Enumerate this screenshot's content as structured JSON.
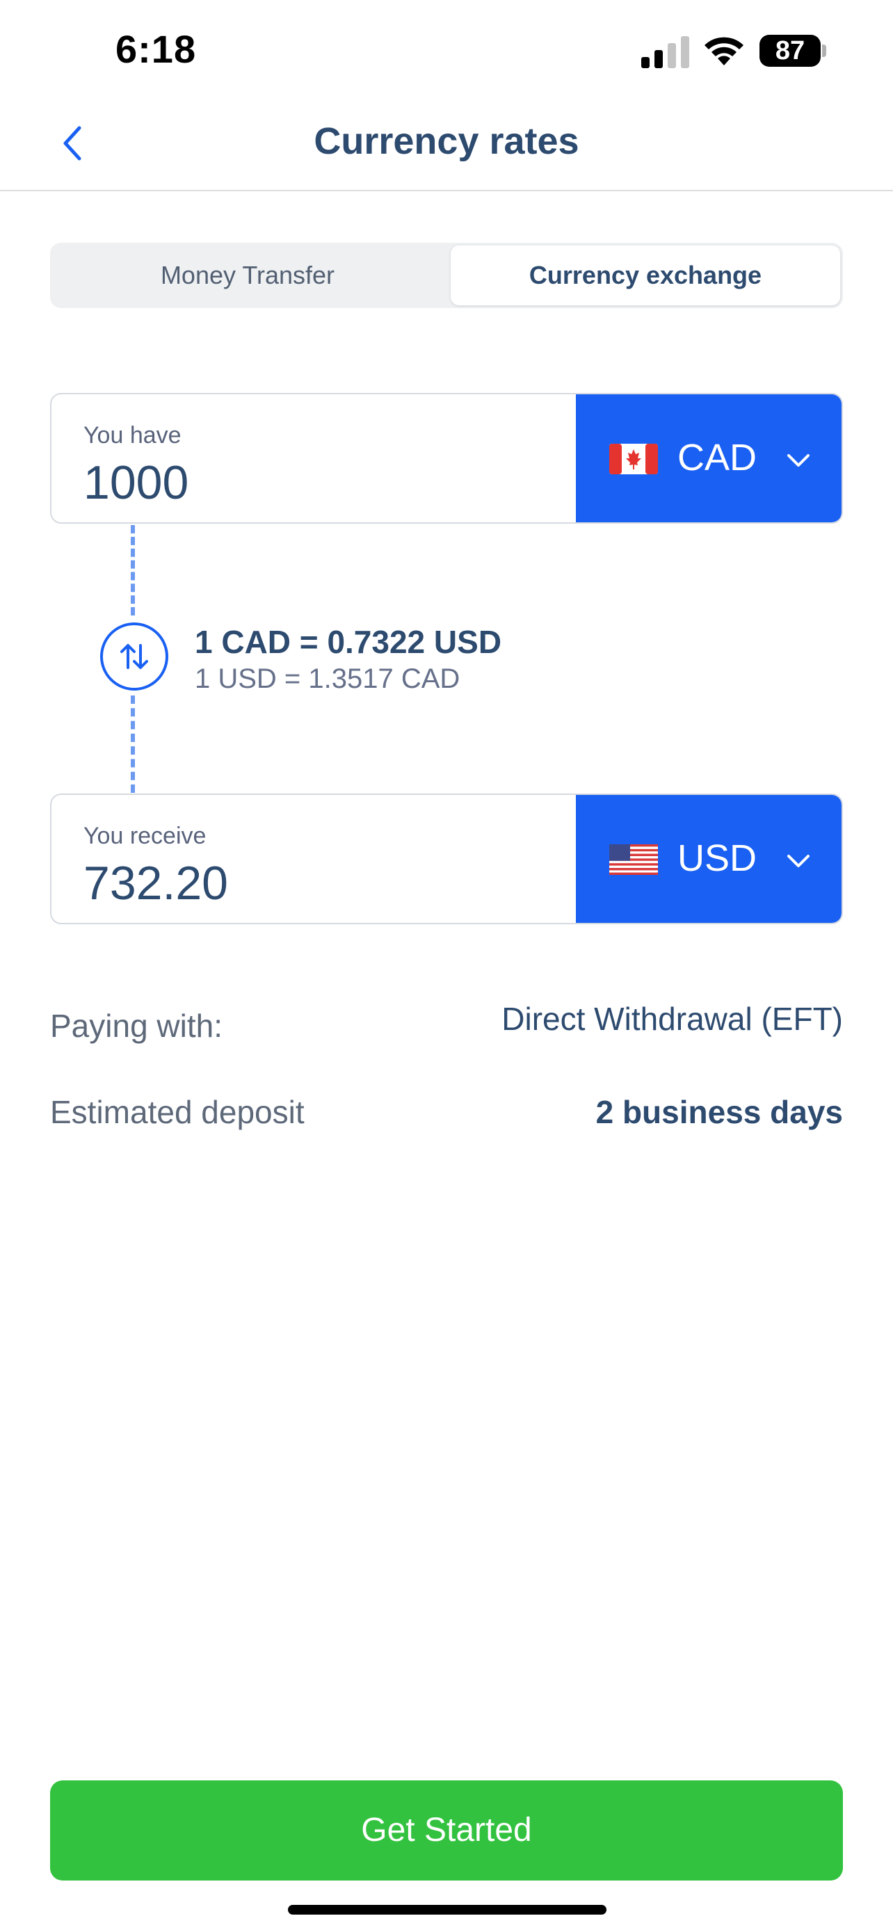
{
  "status_bar": {
    "time": "6:18",
    "battery": "87"
  },
  "header": {
    "title": "Currency rates",
    "back_icon": "chevron-left-icon"
  },
  "tabs": [
    {
      "label": "Money Transfer",
      "active": false
    },
    {
      "label": "Currency exchange",
      "active": true
    }
  ],
  "have": {
    "label": "You have",
    "amount": "1000",
    "currency": "CAD",
    "flag_icon": "canada-flag-icon"
  },
  "rate": {
    "primary": "1 CAD = 0.7322 USD",
    "secondary": "1 USD = 1.3517 CAD",
    "swap_icon": "swap-arrows-icon"
  },
  "receive": {
    "label": "You receive",
    "amount": "732.20",
    "currency": "USD",
    "flag_icon": "us-flag-icon"
  },
  "details": {
    "paying_label": "Paying with:",
    "paying_value": "Direct Withdrawal (EFT)",
    "deposit_label": "Estimated deposit",
    "deposit_value": "2 business days"
  },
  "cta": {
    "label": "Get Started"
  },
  "colors": {
    "accent": "#1960f3",
    "title": "#2d4a6f",
    "cta": "#33c23f"
  }
}
